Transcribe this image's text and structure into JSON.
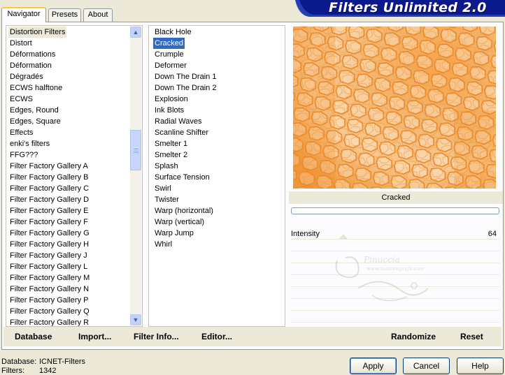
{
  "tabs": {
    "navigator": "Navigator",
    "presets": "Presets",
    "about": "About"
  },
  "app_title": "Filters Unlimited 2.0",
  "categories": [
    "Distortion Filters",
    "Distort",
    "Déformations",
    "Déformation",
    "Dégradés",
    "ECWS halftone",
    "ECWS",
    "Edges, Round",
    "Edges, Square",
    "Effects",
    "enki's filters",
    "FFG???",
    "Filter Factory Gallery A",
    "Filter Factory Gallery B",
    "Filter Factory Gallery C",
    "Filter Factory Gallery D",
    "Filter Factory Gallery E",
    "Filter Factory Gallery F",
    "Filter Factory Gallery G",
    "Filter Factory Gallery H",
    "Filter Factory Gallery J",
    "Filter Factory Gallery L",
    "Filter Factory Gallery M",
    "Filter Factory Gallery N",
    "Filter Factory Gallery P",
    "Filter Factory Gallery Q",
    "Filter Factory Gallery R"
  ],
  "selected_category": "Distortion Filters",
  "filters": [
    "Black Hole",
    "Cracked",
    "Crumple",
    "Deformer",
    "Down The Drain 1",
    "Down The Drain 2",
    "Explosion",
    "Ink Blots",
    "Radial Waves",
    "Scanline Shifter",
    "Smelter 1",
    "Smelter 2",
    "Splash",
    "Surface Tension",
    "Swirl",
    "Twister",
    "Warp (horizontal)",
    "Warp (vertical)",
    "Warp Jump",
    "Whirl"
  ],
  "selected_filter": "Cracked",
  "preview": {
    "caption": "Cracked",
    "progress": 0
  },
  "params": [
    {
      "label": "Intensity",
      "value": "64"
    }
  ],
  "watermark": {
    "name": "Pinuccia",
    "site": "www.maidiregrafica.eu"
  },
  "action_buttons": {
    "database": "Database",
    "import": "Import...",
    "filter_info": "Filter Info...",
    "editor": "Editor...",
    "randomize": "Randomize",
    "reset": "Reset"
  },
  "footer": {
    "database_label": "Database:",
    "database_value": "ICNET-Filters",
    "filters_label": "Filters:",
    "filters_value": "1342"
  },
  "dialog_buttons": {
    "apply": "Apply",
    "cancel": "Cancel",
    "help": "Help"
  },
  "colors": {
    "selection": "#316ac5",
    "banner": "#0a1a8c",
    "preview_orange": "#f08a24"
  }
}
